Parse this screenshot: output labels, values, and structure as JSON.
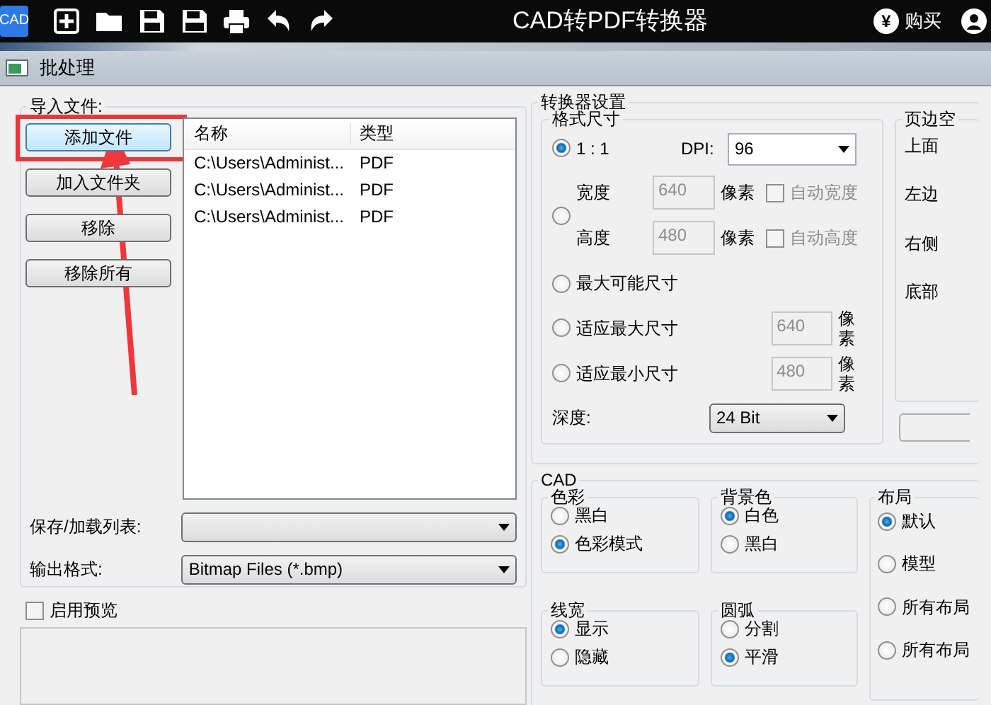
{
  "app_bar": {
    "logo": "CAD",
    "title": "CAD转PDF转换器",
    "buy": "购买",
    "yen": "¥"
  },
  "dialog": {
    "title": "批处理"
  },
  "import_group": {
    "title": "导入文件:",
    "buttons": [
      {
        "label": "添加文件",
        "highlighted": true
      },
      {
        "label": "加入文件夹",
        "highlighted": false
      },
      {
        "label": "移除",
        "highlighted": false
      },
      {
        "label": "移除所有",
        "highlighted": false
      }
    ],
    "list": {
      "columns": [
        "名称",
        "类型"
      ],
      "rows": [
        [
          "C:\\Users\\Administ...",
          "PDF"
        ],
        [
          "C:\\Users\\Administ...",
          "PDF"
        ],
        [
          "C:\\Users\\Administ...",
          "PDF"
        ]
      ]
    },
    "save_load": {
      "label": "保存/加载列表:"
    },
    "output_format": {
      "label": "输出格式:",
      "value": "Bitmap Files (*.bmp)"
    }
  },
  "preview": {
    "label": "启用预览",
    "checked": false
  },
  "converter": {
    "title": "转换器设置",
    "format_size": {
      "title": "格式尺寸",
      "ratio": {
        "label": "1 : 1",
        "selected": true
      },
      "dpi": {
        "label": "DPI:",
        "value": "96"
      },
      "custom": {
        "selected": false,
        "fields": [
          {
            "label": "宽度",
            "value": "640",
            "unit": "像素",
            "auto": "自动宽度",
            "checked": false
          },
          {
            "label": "高度",
            "value": "480",
            "unit": "像素",
            "auto": "自动高度",
            "checked": false
          }
        ]
      },
      "max_possible": {
        "label": "最大可能尺寸",
        "selected": false
      },
      "fits": [
        {
          "label": "适应最大尺寸",
          "selected": false,
          "value": "640",
          "unit": "像素"
        },
        {
          "label": "适应最小尺寸",
          "selected": false,
          "value": "480",
          "unit": "像素"
        }
      ],
      "depth": {
        "label": "深度:",
        "value": "24 Bit"
      }
    },
    "margins": {
      "title": "页边空",
      "labels": [
        "上面",
        "左边",
        "右侧",
        "底部"
      ]
    }
  },
  "cad": {
    "title": "CAD",
    "groups": [
      {
        "title": "色彩",
        "options": [
          {
            "label": "黑白",
            "selected": false
          },
          {
            "label": "色彩模式",
            "selected": true
          }
        ]
      },
      {
        "title": "背景色",
        "options": [
          {
            "label": "白色",
            "selected": true
          },
          {
            "label": "黑白",
            "selected": false
          }
        ]
      },
      {
        "title": "线宽",
        "options": [
          {
            "label": "显示",
            "selected": true
          },
          {
            "label": "隐藏",
            "selected": false
          }
        ]
      },
      {
        "title": "圆弧",
        "options": [
          {
            "label": "分割",
            "selected": false
          },
          {
            "label": "平滑",
            "selected": true
          }
        ]
      }
    ],
    "layout": {
      "title": "布局",
      "options": [
        {
          "label": "默认",
          "selected": true
        },
        {
          "label": "模型",
          "selected": false
        },
        {
          "label": "所有布局",
          "selected": false
        },
        {
          "label": "所有布局",
          "selected": false
        }
      ]
    }
  }
}
